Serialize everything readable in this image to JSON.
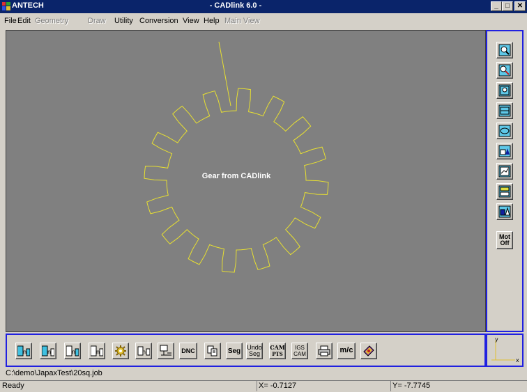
{
  "window": {
    "brand": "ANTECH",
    "title": "- CADlink 6.0 -",
    "minimize_label": "_",
    "maximize_label": "□",
    "close_label": "✕"
  },
  "menu": [
    {
      "label": "File",
      "enabled": true
    },
    {
      "label": "Edit",
      "enabled": true
    },
    {
      "label": "Geometry",
      "enabled": false
    },
    {
      "label": "Draw",
      "enabled": false
    },
    {
      "label": "Utility",
      "enabled": true
    },
    {
      "label": "Conversion",
      "enabled": true
    },
    {
      "label": "View",
      "enabled": true
    },
    {
      "label": "Help",
      "enabled": true
    },
    {
      "label": "Main View",
      "enabled": false
    }
  ],
  "canvas": {
    "label": "Gear from CADlink",
    "background": "#808080",
    "geometry_color": "#e8e030",
    "gear": {
      "teeth": 16,
      "tooth_width_ratio": 0.45
    }
  },
  "right_toolbar": [
    {
      "name": "zoom-icon"
    },
    {
      "name": "zoom-pan-icon"
    },
    {
      "name": "zoom-window-icon"
    },
    {
      "name": "zoom-fit-icon"
    },
    {
      "name": "zoom-previous-icon"
    },
    {
      "name": "view-3d-icon"
    },
    {
      "name": "view-grid-icon"
    },
    {
      "name": "view-layers-icon"
    },
    {
      "name": "view-solid-icon"
    },
    {
      "name": "motion-off",
      "text1": "Mot",
      "text2": "Off"
    }
  ],
  "bottom_toolbar": [
    {
      "name": "convert-a-icon"
    },
    {
      "name": "convert-b-icon"
    },
    {
      "name": "convert-c-icon"
    },
    {
      "name": "convert-d-icon"
    },
    {
      "name": "gear-wizard-icon"
    },
    {
      "name": "transfer-icon"
    },
    {
      "name": "machine-setup-icon"
    },
    {
      "name": "dnc",
      "text1": "DNC"
    },
    {
      "name": "copy-icon"
    },
    {
      "name": "seg",
      "text1": "Seg"
    },
    {
      "name": "undo-seg",
      "text1": "Undo",
      "text2": "Seg"
    },
    {
      "name": "cam-pts",
      "text1": "CAM",
      "text2": "PTS"
    },
    {
      "name": "igs-cam",
      "text1": "IGS",
      "text2": "CAM"
    },
    {
      "name": "print-icon"
    },
    {
      "name": "mc",
      "text1": "m/c"
    },
    {
      "name": "book-icon"
    }
  ],
  "axis": {
    "x_label": "x",
    "y_label": "y"
  },
  "path": "C:\\demo\\JapaxTest\\20sq.job",
  "status": {
    "state": "Ready",
    "x": "X= -0.7127",
    "y": "Y= -7.7745"
  }
}
